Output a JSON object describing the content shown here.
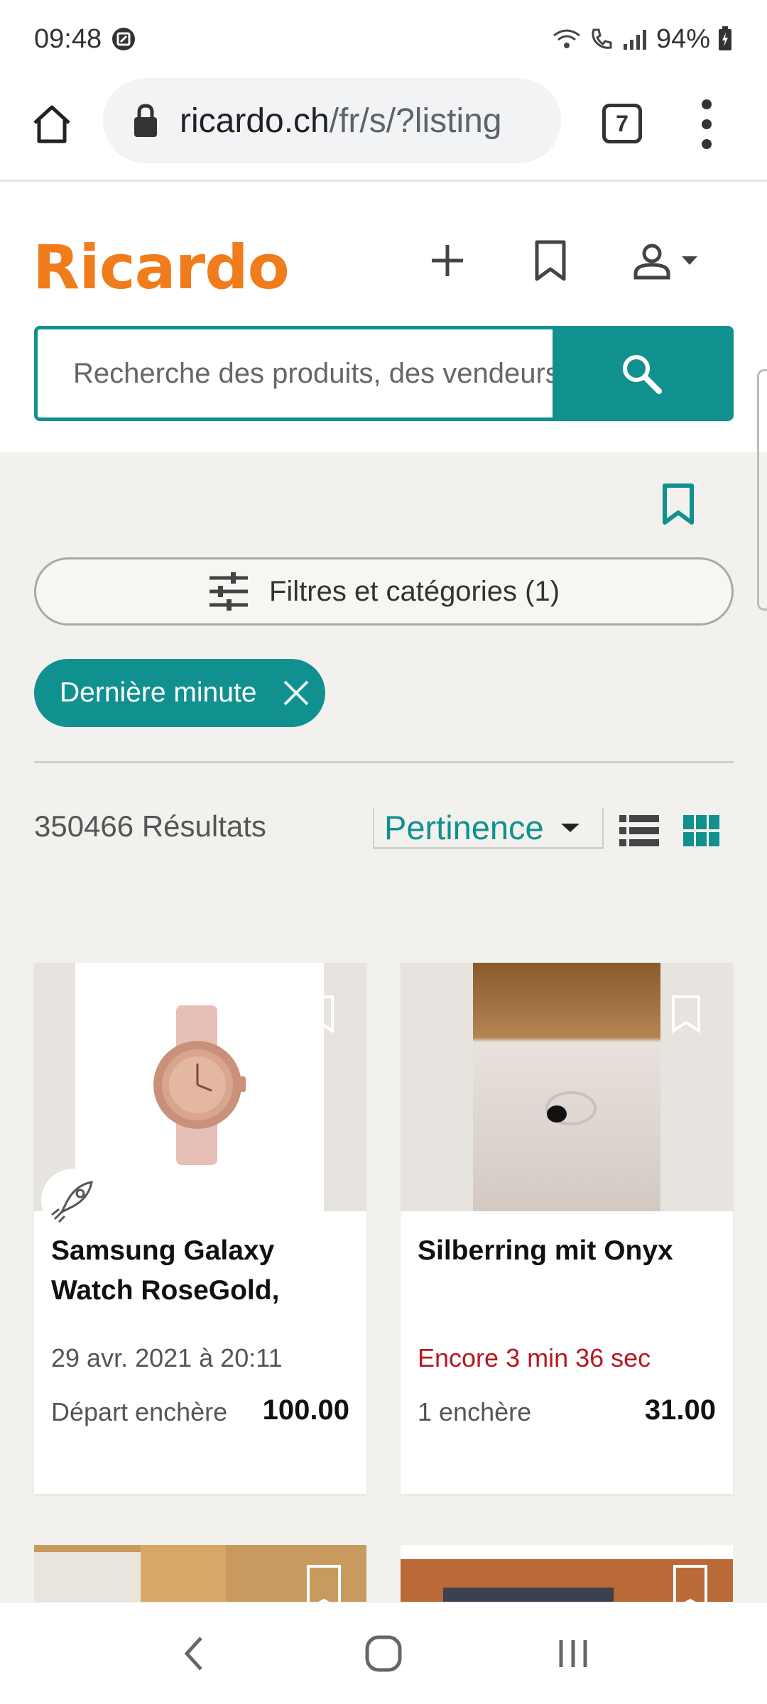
{
  "status_bar": {
    "time": "09:48",
    "battery": "94%",
    "icons": [
      "screenshot-icon",
      "wifi-calling-icon",
      "signal-icon",
      "battery-icon"
    ]
  },
  "browser": {
    "url_domain": "ricardo.ch",
    "url_path": "/fr/s/?listing",
    "tab_count": "7"
  },
  "site": {
    "logo": "Ricardo",
    "search_placeholder": "Recherche des produits, des vendeurs",
    "accent_color": "#10918f",
    "brand_color": "#f07c1b"
  },
  "filters": {
    "button_label": "Filtres et catégories (1)",
    "active_chip": "Dernière minute"
  },
  "results": {
    "count_label": "350466 Résultats",
    "sort_label": "Pertinence"
  },
  "listings": [
    {
      "title": "Samsung Galaxy Watch RoseGold,",
      "meta": "29 avr. 2021 à 20:11",
      "bid_label": "Départ enchère",
      "price": "100.00"
    },
    {
      "title": "Silberring mit Onyx",
      "meta": "Encore 3 min 36 sec",
      "bid_label": "1 enchère",
      "price": "31.00"
    }
  ]
}
